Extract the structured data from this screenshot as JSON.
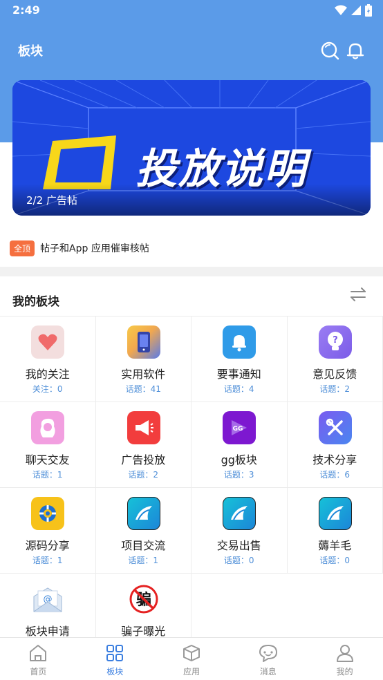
{
  "status": {
    "time": "2:49"
  },
  "header": {
    "title": "板块"
  },
  "banner": {
    "text": "投放说明",
    "counter": "2/2 广告帖"
  },
  "notice": {
    "badge": "全顶",
    "text": "帖子和App 应用催审核帖"
  },
  "section": {
    "title": "我的板块"
  },
  "boards": [
    {
      "name": "我的关注",
      "meta": "关注：0",
      "icon": "heart-icon"
    },
    {
      "name": "实用软件",
      "meta": "话题：41",
      "icon": "phone-icon"
    },
    {
      "name": "要事通知",
      "meta": "话题：4",
      "icon": "bell-icon"
    },
    {
      "name": "意见反馈",
      "meta": "话题：2",
      "icon": "question-bulb-icon"
    },
    {
      "name": "聊天交友",
      "meta": "话题：1",
      "icon": "girl-avatar-icon"
    },
    {
      "name": "广告投放",
      "meta": "话题：2",
      "icon": "megaphone-icon"
    },
    {
      "name": "gg板块",
      "meta": "话题：3",
      "icon": "gg-logo-icon"
    },
    {
      "name": "技术分享",
      "meta": "话题：6",
      "icon": "tools-icon"
    },
    {
      "name": "源码分享",
      "meta": "话题：1",
      "icon": "lifebuoy-icon"
    },
    {
      "name": "项目交流",
      "meta": "话题：1",
      "icon": "ship-icon"
    },
    {
      "name": "交易出售",
      "meta": "话题：0",
      "icon": "ship-icon"
    },
    {
      "name": "薅羊毛",
      "meta": "话题：0",
      "icon": "ship-icon"
    },
    {
      "name": "板块申请",
      "meta": "",
      "icon": "mail-icon"
    },
    {
      "name": "骗子曝光",
      "meta": "",
      "icon": "no-scam-icon"
    }
  ],
  "tabs": [
    {
      "label": "首页",
      "icon": "home-icon"
    },
    {
      "label": "板块",
      "icon": "grid-icon"
    },
    {
      "label": "应用",
      "icon": "box-icon"
    },
    {
      "label": "消息",
      "icon": "chat-icon"
    },
    {
      "label": "我的",
      "icon": "user-icon"
    }
  ],
  "colors": {
    "header": "#5b9be8",
    "accent": "#3a7ee0",
    "badge": "#f56f3f",
    "meta": "#4f8fd8"
  }
}
